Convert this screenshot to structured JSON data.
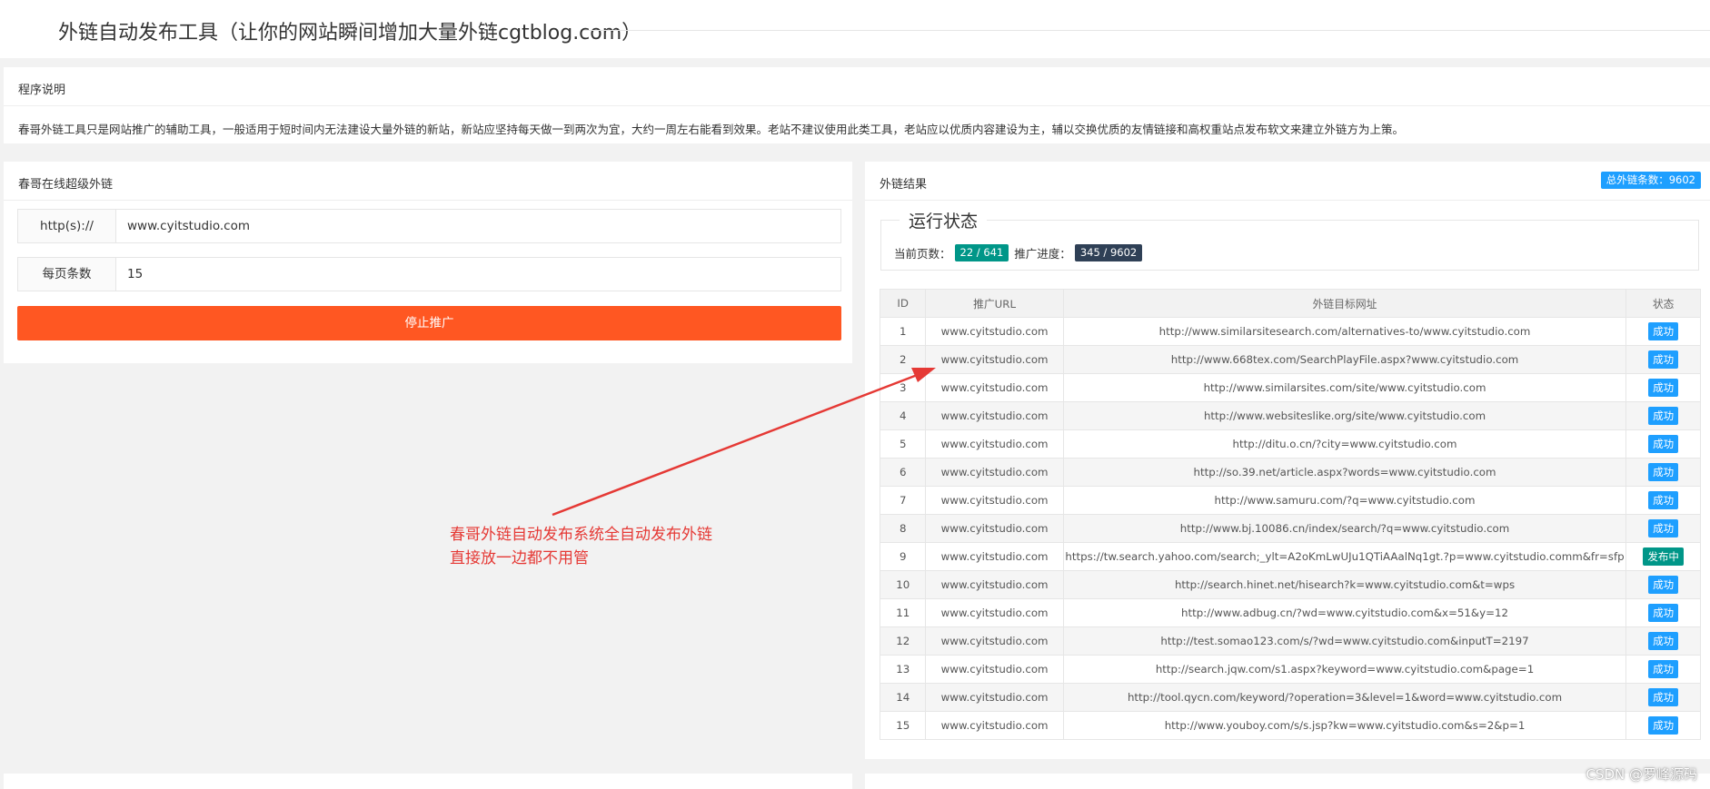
{
  "header": {
    "title": "外链自动发布工具（让你的网站瞬间增加大量外链cgtblog.com）"
  },
  "description": {
    "title": "程序说明",
    "text": "春哥外链工具只是网站推广的辅助工具，一般适用于短时间内无法建设大量外链的新站，新站应坚持每天做一到两次为宜，大约一周左右能看到效果。老站不建议使用此类工具，老站应以优质内容建设为主，辅以交换优质的友情链接和高权重站点发布软文来建立外链方为上策。"
  },
  "form": {
    "title": "春哥在线超级外链",
    "url_label": "http(s)://",
    "url_value": "www.cyitstudio.com",
    "per_page_label": "每页条数",
    "per_page_value": "15",
    "stop_button": "停止推广"
  },
  "results": {
    "title": "外链结果",
    "total_badge": "总外链条数：9602",
    "status_legend": "运行状态",
    "current_page_label": "当前页数：",
    "current_page_value": "22 / 641",
    "progress_label": "推广进度：",
    "progress_value": "345 / 9602",
    "columns": [
      "ID",
      "推广URL",
      "外链目标网址",
      "状态"
    ],
    "rows": [
      {
        "id": "1",
        "url": "www.cyitstudio.com",
        "target": "http://www.similarsitesearch.com/alternatives-to/www.cyitstudio.com",
        "status": "成功"
      },
      {
        "id": "2",
        "url": "www.cyitstudio.com",
        "target": "http://www.668tex.com/SearchPlayFile.aspx?www.cyitstudio.com",
        "status": "成功"
      },
      {
        "id": "3",
        "url": "www.cyitstudio.com",
        "target": "http://www.similarsites.com/site/www.cyitstudio.com",
        "status": "成功"
      },
      {
        "id": "4",
        "url": "www.cyitstudio.com",
        "target": "http://www.websiteslike.org/site/www.cyitstudio.com",
        "status": "成功"
      },
      {
        "id": "5",
        "url": "www.cyitstudio.com",
        "target": "http://ditu.o.cn/?city=www.cyitstudio.com",
        "status": "成功"
      },
      {
        "id": "6",
        "url": "www.cyitstudio.com",
        "target": "http://so.39.net/article.aspx?words=www.cyitstudio.com",
        "status": "成功"
      },
      {
        "id": "7",
        "url": "www.cyitstudio.com",
        "target": "http://www.samuru.com/?q=www.cyitstudio.com",
        "status": "成功"
      },
      {
        "id": "8",
        "url": "www.cyitstudio.com",
        "target": "http://www.bj.10086.cn/index/search/?q=www.cyitstudio.com",
        "status": "成功"
      },
      {
        "id": "9",
        "url": "www.cyitstudio.com",
        "target": "https://tw.search.yahoo.com/search;_ylt=A2oKmLwUJu1QTiAAalNq1gt.?p=www.cyitstudio.comm&fr=sfp",
        "status": "发布中"
      },
      {
        "id": "10",
        "url": "www.cyitstudio.com",
        "target": "http://search.hinet.net/hisearch?k=www.cyitstudio.com&t=wps",
        "status": "成功"
      },
      {
        "id": "11",
        "url": "www.cyitstudio.com",
        "target": "http://www.adbug.cn/?wd=www.cyitstudio.com&x=51&y=12",
        "status": "成功"
      },
      {
        "id": "12",
        "url": "www.cyitstudio.com",
        "target": "http://test.somao123.com/s/?wd=www.cyitstudio.com&inputT=2197",
        "status": "成功"
      },
      {
        "id": "13",
        "url": "www.cyitstudio.com",
        "target": "http://search.jqw.com/s1.aspx?keyword=www.cyitstudio.com&page=1",
        "status": "成功"
      },
      {
        "id": "14",
        "url": "www.cyitstudio.com",
        "target": "http://tool.qycn.com/keyword/?operation=3&level=1&word=www.cyitstudio.com",
        "status": "成功"
      },
      {
        "id": "15",
        "url": "www.cyitstudio.com",
        "target": "http://www.youboy.com/s/s.jsp?kw=www.cyitstudio.com&s=2&p=1",
        "status": "成功"
      }
    ]
  },
  "annotation": {
    "line1": "春哥外链自动发布系统全自动发布外链",
    "line2": "直接放一边都不用管",
    "color": "#e53935"
  },
  "watermark": "CSDN @罗峰源码",
  "colors": {
    "accent_orange": "#ff5722",
    "badge_blue": "#1e9fff",
    "badge_green": "#009688",
    "badge_dark": "#2f4056"
  }
}
